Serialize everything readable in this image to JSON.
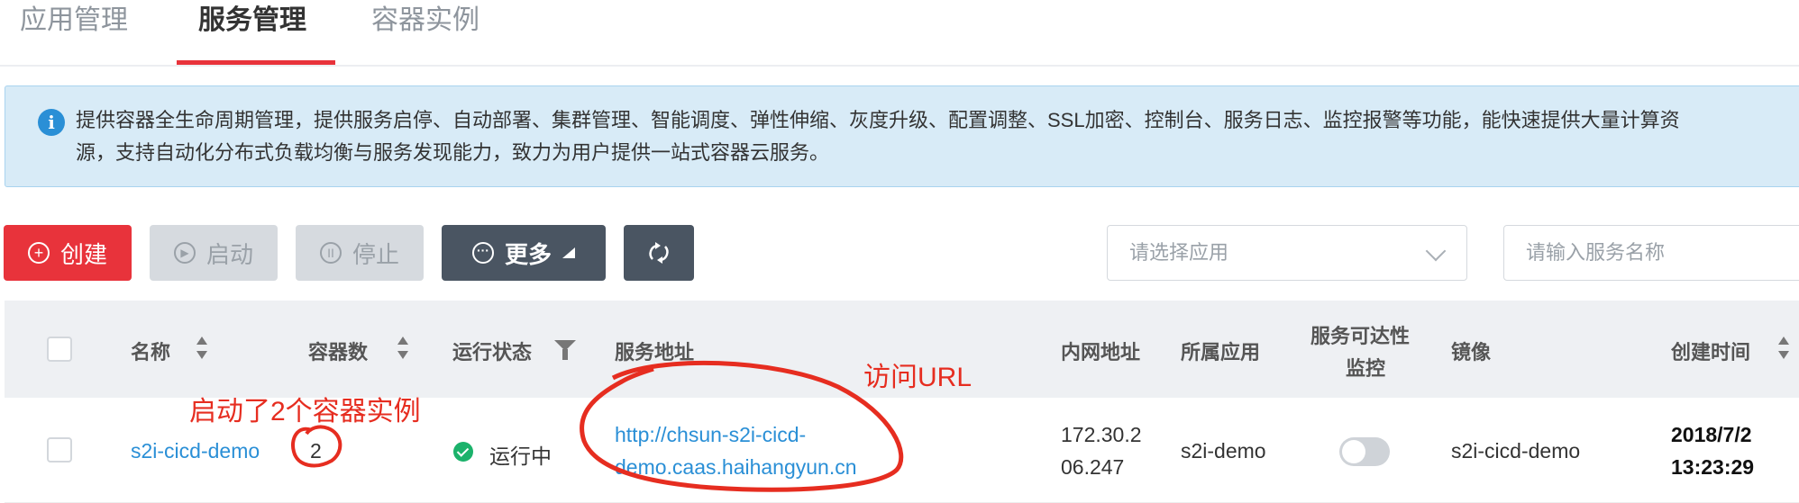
{
  "tabs": [
    {
      "label": "应用管理"
    },
    {
      "label": "服务管理",
      "active": true
    },
    {
      "label": "容器实例"
    }
  ],
  "alert": {
    "icon": "info-icon",
    "line1": "提供容器全生命周期管理，提供服务启停、自动部署、集群管理、智能调度、弹性伸缩、灰度升级、配置调整、SSL加密、控制台、服务日志、监控报警等功能，能快速提供大量计算资",
    "line2": "源，支持自动化分布式负载均衡与服务发现能力，致力为用户提供一站式容器云服务。"
  },
  "toolbar": {
    "create": "创建",
    "start": "启动",
    "stop": "停止",
    "more": "更多",
    "app_select_placeholder": "请选择应用",
    "search_placeholder": "请输入服务名称"
  },
  "table": {
    "headers": {
      "name": "名称",
      "containers": "容器数",
      "status": "运行状态",
      "service_url": "服务地址",
      "internal_ip": "内网地址",
      "app": "所属应用",
      "reachability_line1": "服务可达性",
      "reachability_line2": "监控",
      "image": "镜像",
      "created": "创建时间"
    },
    "rows": [
      {
        "name": "s2i-cicd-demo",
        "containers": "2",
        "status": "运行中",
        "url_line1": "http://chsun-s2i-cicd-",
        "url_line2": "demo.caas.haihangyun.cn",
        "ip_line1": "172.30.2",
        "ip_line2": "06.247",
        "app": "s2i-demo",
        "monitoring_on": false,
        "image": "s2i-cicd-demo",
        "created_line1": "2018/7/2",
        "created_line2": "13:23:29"
      }
    ]
  },
  "annotations": {
    "containers_note": "启动了2个容器实例",
    "url_note": "访问URL",
    "color": "#e62d20"
  },
  "colors": {
    "primary": "#e8333b",
    "dark": "#4a5562",
    "link": "#2a8fd6",
    "success": "#1bb26b"
  }
}
